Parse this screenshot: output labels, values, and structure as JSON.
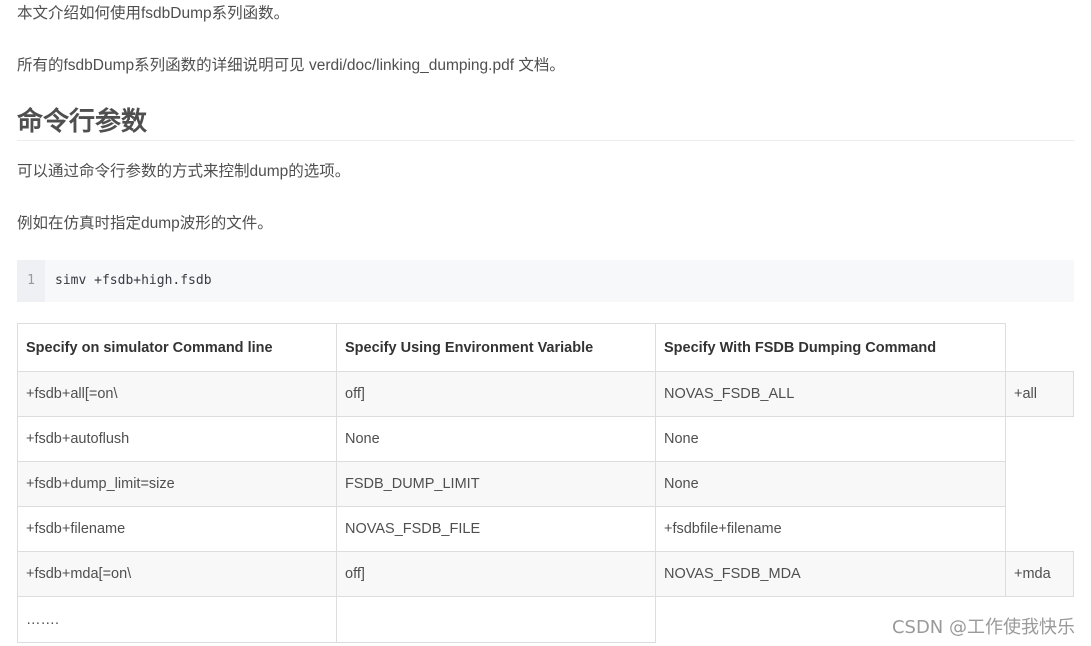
{
  "intro": {
    "line1": "本文介绍如何使用fsdbDump系列函数。",
    "line2": "所有的fsdbDump系列函数的详细说明可见 verdi/doc/linking_dumping.pdf 文档。"
  },
  "section": {
    "title": "命令行参数",
    "para1": "可以通过命令行参数的方式来控制dump的选项。",
    "para2": "例如在仿真时指定dump波形的文件。"
  },
  "code": {
    "line_number": "1",
    "text": "simv +fsdb+high.fsdb"
  },
  "table": {
    "headers": [
      "Specify on simulator Command line",
      "Specify Using Environment Variable",
      "Specify With FSDB Dumping Command"
    ],
    "rows": [
      [
        "+fsdb+all[=on\\",
        "off]",
        "NOVAS_FSDB_ALL",
        "+all"
      ],
      [
        "+fsdb+autoflush",
        "None",
        "None"
      ],
      [
        "+fsdb+dump_limit=size",
        "FSDB_DUMP_LIMIT",
        "None"
      ],
      [
        "+fsdb+filename",
        "NOVAS_FSDB_FILE",
        "+fsdbfile+filename"
      ],
      [
        "+fsdb+mda[=on\\",
        "off]",
        "NOVAS_FSDB_MDA",
        "+mda"
      ],
      [
        "…….",
        ""
      ]
    ]
  },
  "watermark": "CSDN @工作使我快乐"
}
